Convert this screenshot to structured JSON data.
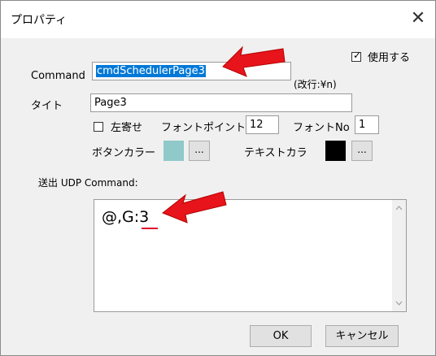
{
  "window": {
    "title": "プロパティ",
    "close_glyph": "✕"
  },
  "use_checkbox": {
    "label": "使用する",
    "checked": true
  },
  "command": {
    "label": "Command",
    "value": "cmdSchedulerPage3",
    "note": "(改行:¥n)"
  },
  "title_field": {
    "label": "タイト",
    "value": "Page3"
  },
  "left_align": {
    "label": "左寄せ",
    "checked": false
  },
  "font_point": {
    "label": "フォントポイント",
    "value": "12"
  },
  "font_no": {
    "label": "フォントNo",
    "value": "1"
  },
  "button_color": {
    "label": "ボタンカラー",
    "color": "#8fc9c9",
    "browse": "..."
  },
  "text_color": {
    "label": "テキストカラ",
    "color": "#000000",
    "browse": "..."
  },
  "udp": {
    "label": "送出 UDP Command:",
    "value": "@,G:3"
  },
  "buttons": {
    "ok": "OK",
    "cancel": "キャンセル"
  },
  "colors": {
    "selection": "#0078d7",
    "arrow": "#e8141b",
    "underline": "#e0102a"
  },
  "icons": {
    "scroll_up": "chevron-up-icon",
    "scroll_down": "chevron-down-icon",
    "close": "close-icon",
    "annotation": "red-arrow-icon"
  }
}
